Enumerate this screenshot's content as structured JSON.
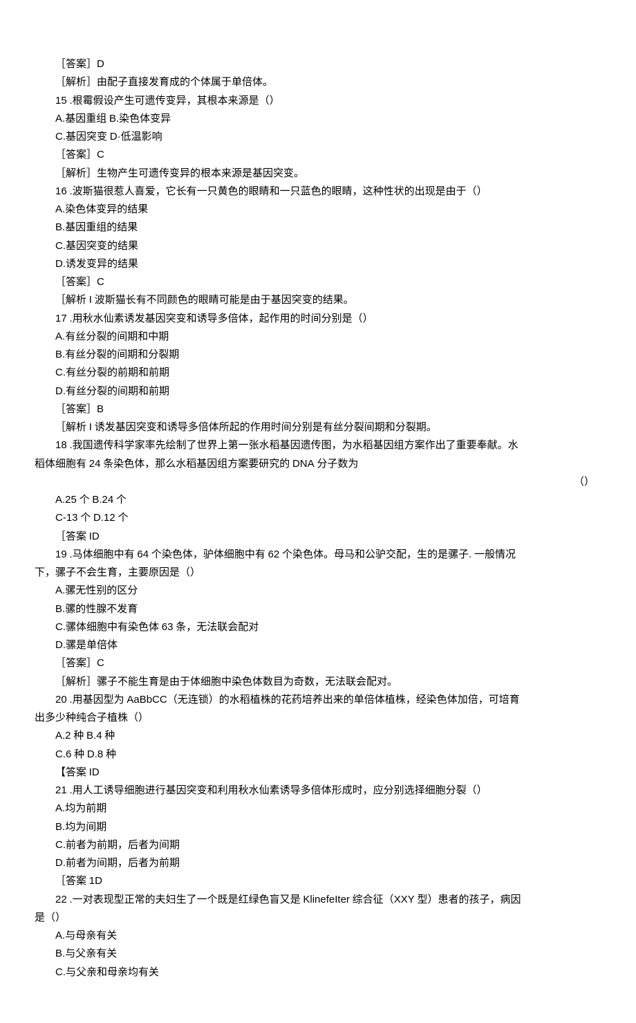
{
  "lines": [
    {
      "type": "ans",
      "text": "［答案］D"
    },
    {
      "type": "exp",
      "text": "［解析］由配子直接发育成的个体属于单倍体。"
    },
    {
      "type": "q",
      "text": "15 .根霉假设产生可遗传变异，其根本来源是（）"
    },
    {
      "type": "opt",
      "text": "A.基因重组 B.染色体变异"
    },
    {
      "type": "opt",
      "text": "C.基因突变 D·低温影响"
    },
    {
      "type": "ans",
      "text": "［答案］C"
    },
    {
      "type": "exp",
      "text": "［解析］生物产生可遗传变异的根本来源是基因突变。"
    },
    {
      "type": "q",
      "text": "16 .波斯猫很惹人喜爱，它长有一只黄色的眼睛和一只蓝色的眼睛，这种性状的出现是由于（）"
    },
    {
      "type": "opt",
      "text": "A.染色体变异的结果"
    },
    {
      "type": "opt",
      "text": "B.基因重组的结果"
    },
    {
      "type": "opt",
      "text": "C.基因突变的结果"
    },
    {
      "type": "opt",
      "text": "D.诱发变异的结果"
    },
    {
      "type": "ans",
      "text": "［答案］C"
    },
    {
      "type": "exp",
      "text": "［解析 I 波斯猫长有不同颜色的眼睛可能是由于基因突变的结果。"
    },
    {
      "type": "q",
      "text": "17 .用秋水仙素诱发基因突变和诱导多倍体，起作用的时间分别是（）"
    },
    {
      "type": "opt",
      "text": "A.有丝分裂的间期和中期"
    },
    {
      "type": "opt",
      "text": "B.有丝分裂的间期和分裂期"
    },
    {
      "type": "opt",
      "text": "C.有丝分裂的前期和前期"
    },
    {
      "type": "opt",
      "text": "D.有丝分裂的间期和前期"
    },
    {
      "type": "ans",
      "text": "［答案］B"
    },
    {
      "type": "exp",
      "text": "［解析 I 诱发基因突变和诱导多倍体所起的作用时间分别是有丝分裂间期和分裂期。"
    },
    {
      "type": "q18a",
      "text": "18 .我国遗传科学家率先绘制了世界上第一张水稻基因遗传图，为水稻基因组方案作出了重要奉献。水"
    },
    {
      "type": "q18b",
      "text": "稻体细胞有 24 条染色体，那么水稻基因组方案要研究的 DNA 分子数为"
    },
    {
      "type": "rightparen",
      "text": "（）"
    },
    {
      "type": "opt",
      "text": "A.25 个 B.24 个"
    },
    {
      "type": "opt",
      "text": "C-13 个 D.12 个"
    },
    {
      "type": "ans",
      "text": "［答案 ID"
    },
    {
      "type": "q",
      "text": "19 .马体细胞中有 64 个染色体，驴体细胞中有 62 个染色体。母马和公驴交配，生的是骡子. 一般情况"
    },
    {
      "type": "cont",
      "text": "下，骡子不会生育，主要原因是（）"
    },
    {
      "type": "opt",
      "text": "A.骡无性别的区分"
    },
    {
      "type": "opt",
      "text": "B.骡的性腺不发育"
    },
    {
      "type": "opt",
      "text": "C.骡体细胞中有染色体 63 条，无法联会配对"
    },
    {
      "type": "opt",
      "text": "D.骡是单倍体"
    },
    {
      "type": "ans",
      "text": "［答案］C"
    },
    {
      "type": "exp",
      "text": "［解析］骡子不能生育是由于体细胞中染色体数目为奇数，无法联会配对。"
    },
    {
      "type": "q",
      "text": "20 .用基因型为 AaBbCC（无连锁）的水稻植株的花药培养出来的单倍体植株，经染色体加倍，可培育"
    },
    {
      "type": "cont",
      "text": "出多少种纯合子植株（）"
    },
    {
      "type": "opt",
      "text": "A.2 种 B.4 种"
    },
    {
      "type": "opt",
      "text": "C.6 种 D.8 种"
    },
    {
      "type": "ans",
      "text": "【答案 ID"
    },
    {
      "type": "q",
      "text": "21 .用人工诱导细胞进行基因突变和利用秋水仙素诱导多倍体形成时，应分别选择细胞分裂（）"
    },
    {
      "type": "opt",
      "text": "A.均为前期"
    },
    {
      "type": "opt",
      "text": "B.均为间期"
    },
    {
      "type": "opt",
      "text": "C.前者为前期，后者为间期"
    },
    {
      "type": "opt",
      "text": "D.前者为间期，后者为前期"
    },
    {
      "type": "ans",
      "text": "［答案 1D"
    },
    {
      "type": "q",
      "text": "22 .一对表现型正常的夫妇生了一个既是红绿色盲又是 KlinefeIter 综合征（XXY 型）患者的孩子，病因"
    },
    {
      "type": "cont",
      "text": "是（）"
    },
    {
      "type": "opt",
      "text": "A.与母亲有关"
    },
    {
      "type": "opt",
      "text": "B.与父亲有关"
    },
    {
      "type": "opt",
      "text": "C.与父亲和母亲均有关"
    }
  ]
}
